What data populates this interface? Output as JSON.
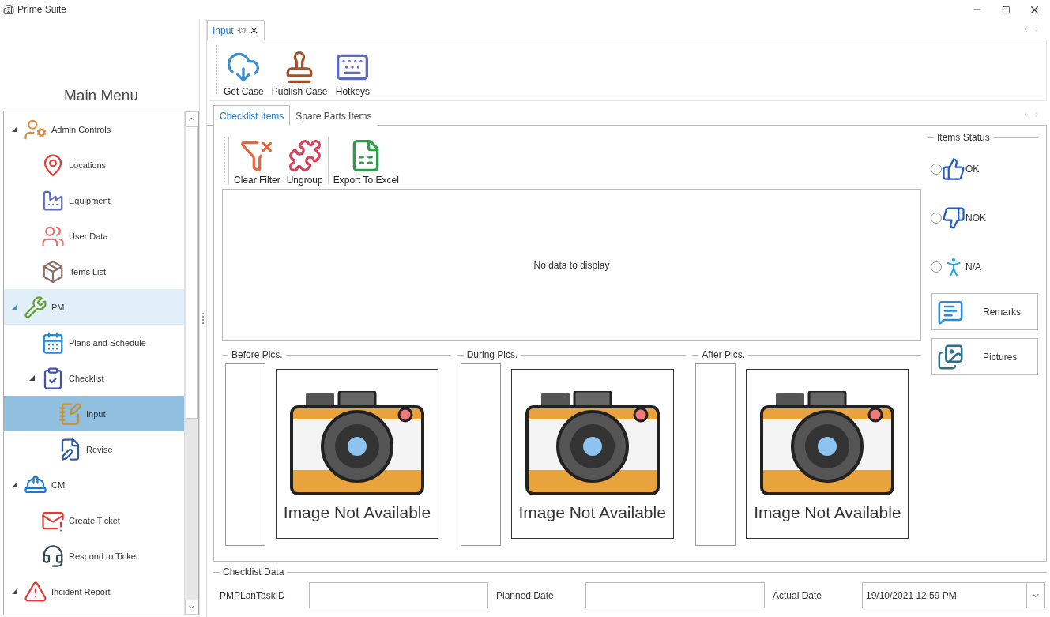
{
  "window": {
    "title": "Prime Suite"
  },
  "sidebar": {
    "title": "Main Menu",
    "items": [
      {
        "label": "Admin Controls",
        "selected": false,
        "hovered": false,
        "expanded": true,
        "children": [
          {
            "label": "Locations",
            "selected": false,
            "hovered": false
          },
          {
            "label": "Equipment",
            "selected": false,
            "hovered": false
          },
          {
            "label": "User Data",
            "selected": false,
            "hovered": false
          },
          {
            "label": "Items List",
            "selected": false,
            "hovered": false
          }
        ]
      },
      {
        "label": "PM",
        "selected": false,
        "hovered": true,
        "expanded": true,
        "children": [
          {
            "label": "Plans and Schedule",
            "selected": false,
            "hovered": false
          },
          {
            "label": "Checklist",
            "selected": false,
            "hovered": false,
            "expanded": true,
            "children": [
              {
                "label": "Input",
                "selected": true,
                "hovered": false
              },
              {
                "label": "Revise",
                "selected": false,
                "hovered": false
              }
            ]
          }
        ]
      },
      {
        "label": "CM",
        "selected": false,
        "hovered": false,
        "expanded": true,
        "children": [
          {
            "label": "Create Ticket",
            "selected": false,
            "hovered": false
          },
          {
            "label": "Respond to Ticket",
            "selected": false,
            "hovered": false
          }
        ]
      },
      {
        "label": "Incident Report",
        "selected": false,
        "hovered": false,
        "expanded": true
      }
    ]
  },
  "document_tab": {
    "label": "Input",
    "selected": true
  },
  "toolbar": {
    "buttons": [
      {
        "label": "Get Case"
      },
      {
        "label": "Publish Case"
      },
      {
        "label": "Hotkeys"
      }
    ]
  },
  "tabs": [
    {
      "label": "Checklist Items",
      "selected": true
    },
    {
      "label": "Spare Parts Items",
      "selected": false
    }
  ],
  "grid_toolbar": {
    "buttons": [
      {
        "label": "Clear Filter"
      },
      {
        "label": "Ungroup"
      },
      {
        "label": "Export To Excel"
      }
    ]
  },
  "grid": {
    "empty_text": "No data to display"
  },
  "pictures": [
    {
      "title": "Before Pics.",
      "placeholder_text": "Image Not Available"
    },
    {
      "title": "During Pics.",
      "placeholder_text": "Image Not Available"
    },
    {
      "title": "After Pics.",
      "placeholder_text": "Image Not Available"
    }
  ],
  "items_status": {
    "title": "Items Status",
    "options": [
      {
        "label": "OK",
        "selected": false
      },
      {
        "label": "NOK",
        "selected": false
      },
      {
        "label": "N/A",
        "selected": false
      }
    ]
  },
  "side_buttons": [
    {
      "label": "Remarks"
    },
    {
      "label": "Pictures"
    }
  ],
  "checklist_data": {
    "title": "Checklist Data",
    "fields": [
      {
        "label": "PMPLanTaskID",
        "kind": "text"
      },
      {
        "label": "Planned Date",
        "kind": "text"
      },
      {
        "label": "Actual Date",
        "kind": "dropdown",
        "value": "19/10/2021 12:59 PM"
      }
    ]
  }
}
